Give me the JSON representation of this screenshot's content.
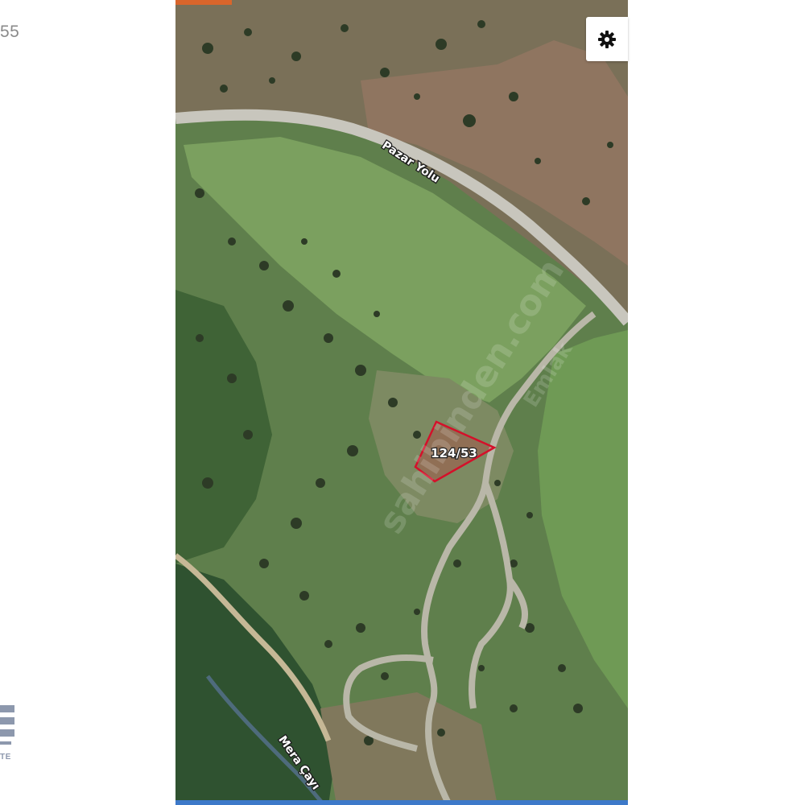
{
  "left_fragment": {
    "text": "55"
  },
  "brand_fragment": {
    "text": "TE"
  },
  "map": {
    "road_label": "Pazar Yolu",
    "river_label": "Mera Çayı",
    "parcel_label": "124/53",
    "watermark": "sahibinden.com",
    "watermark_sub": "Emlak"
  },
  "settings": {
    "icon": "gear-icon"
  },
  "colors": {
    "top_strip": "#d9652b",
    "bottom_strip": "#3d79c9",
    "parcel_outline": "#d4102a",
    "brand": "#8d98ad"
  }
}
